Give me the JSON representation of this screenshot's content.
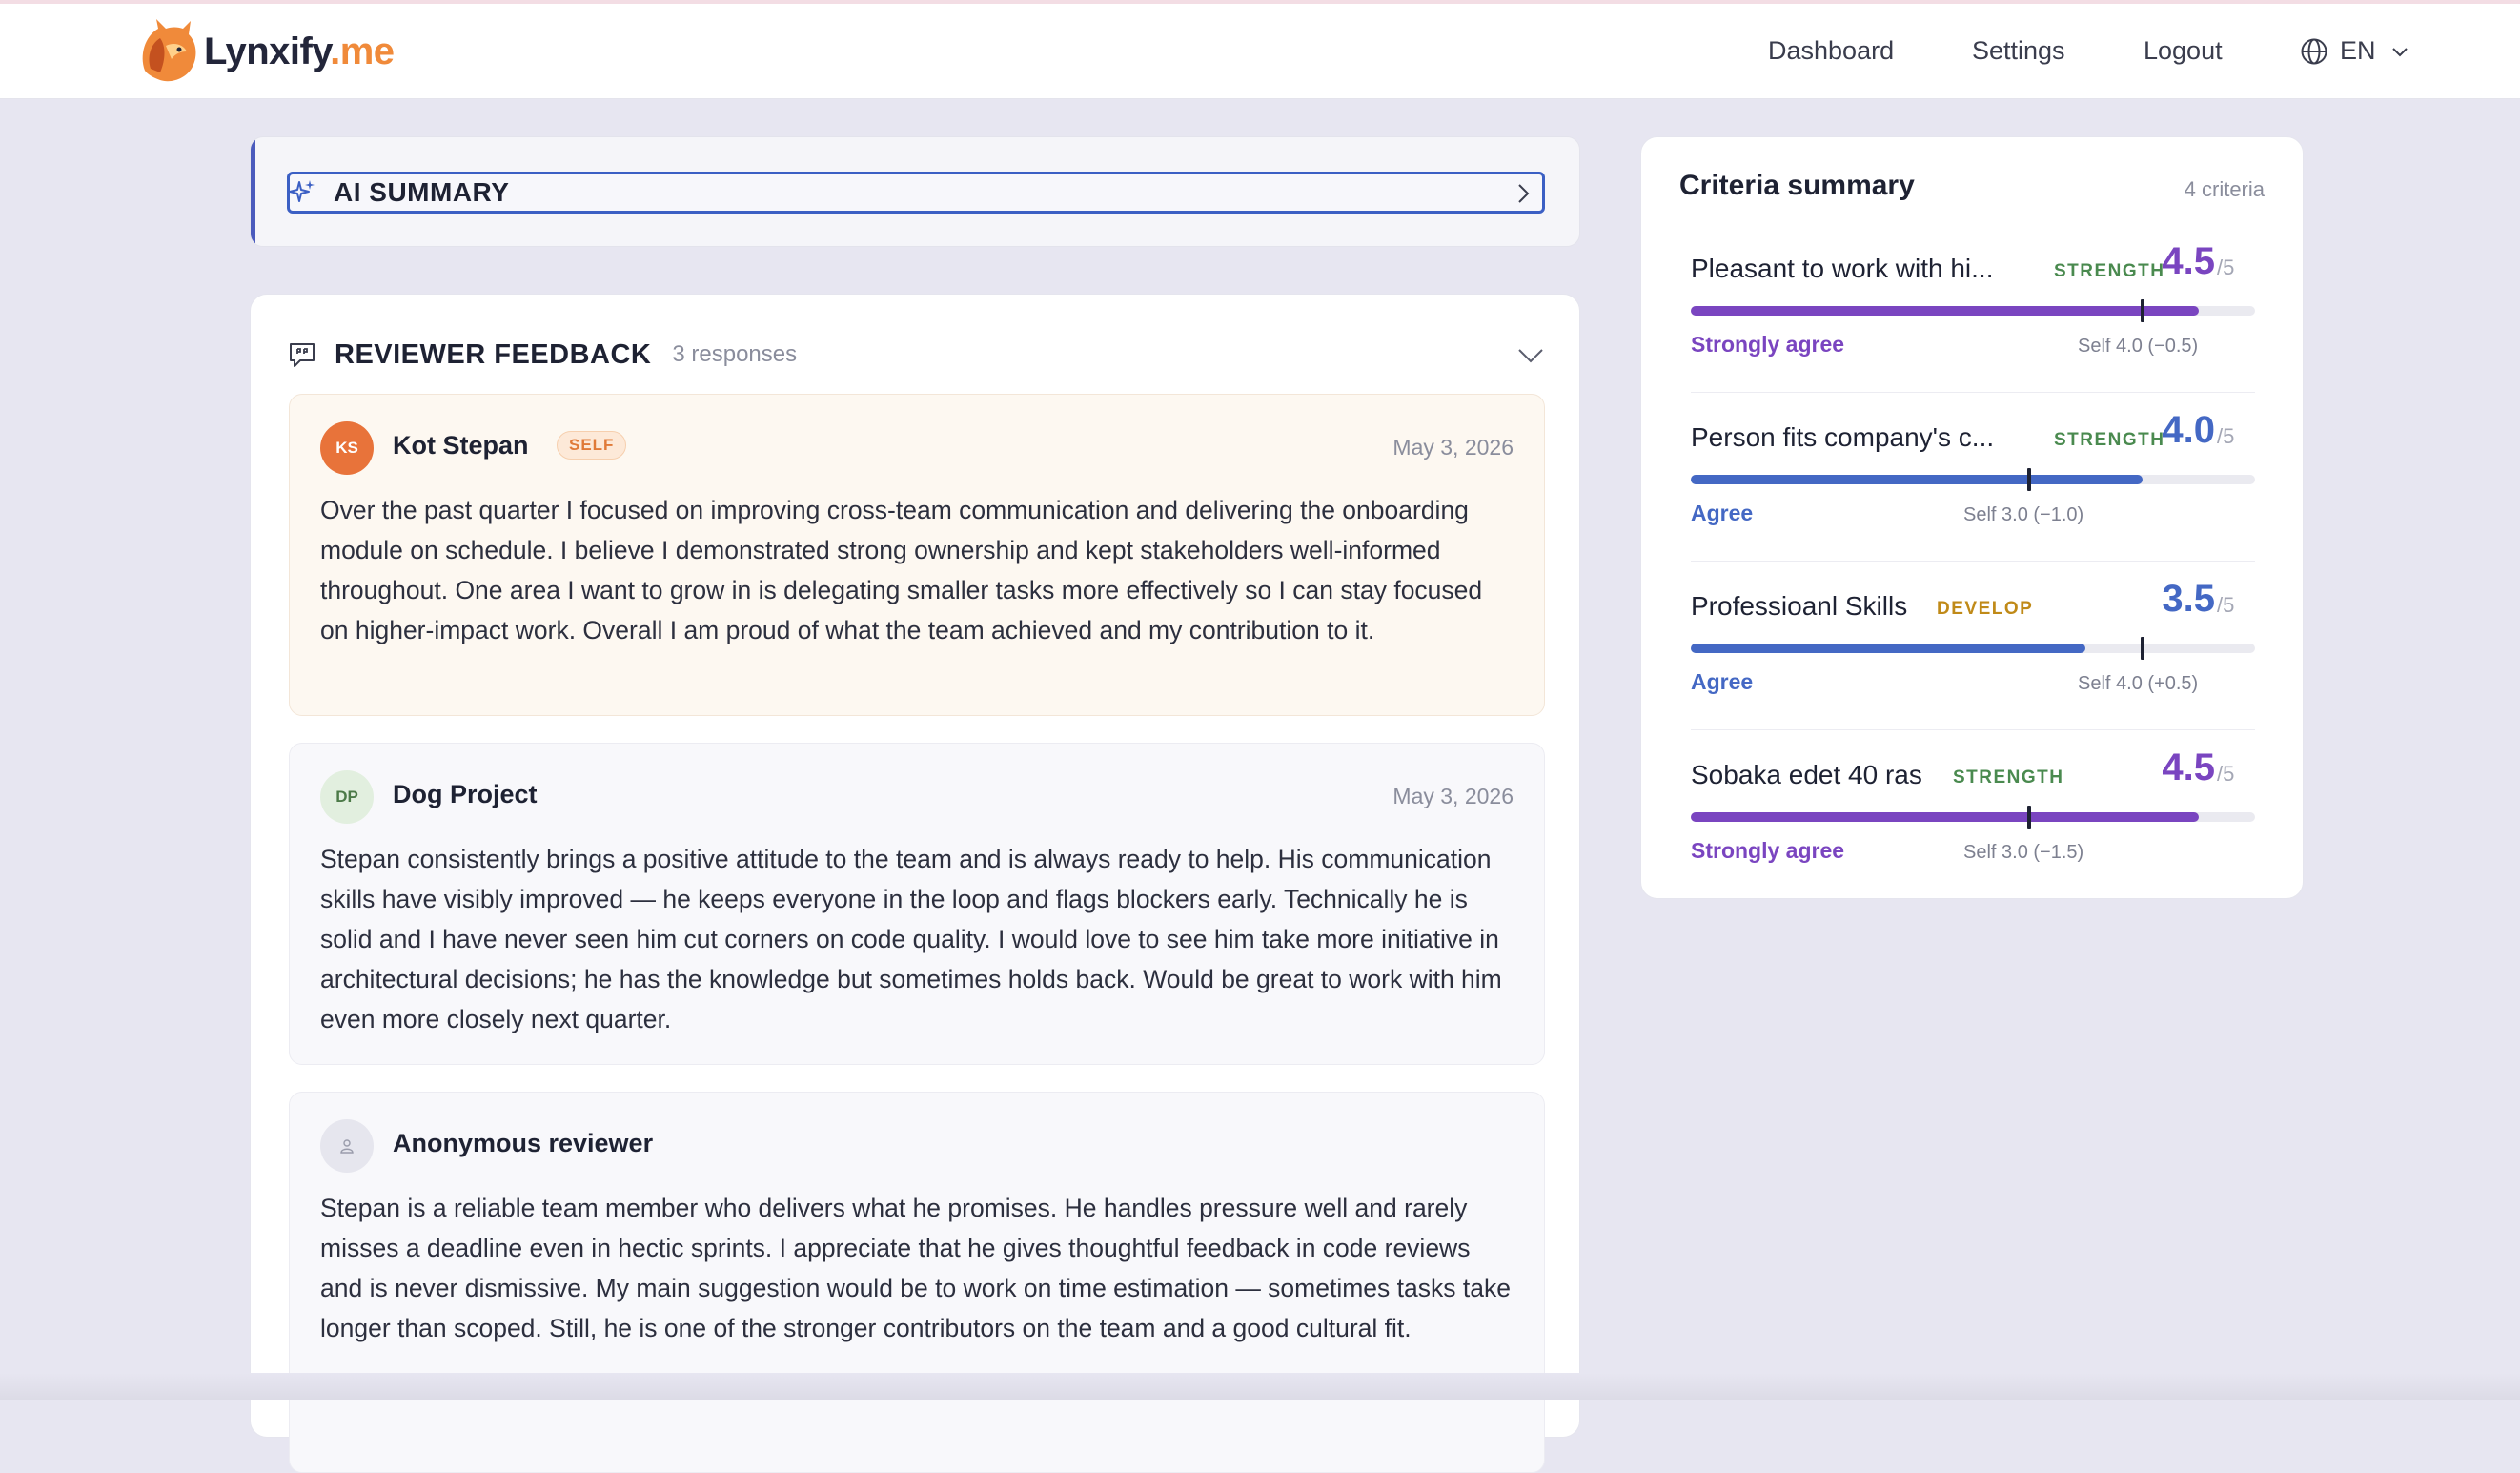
{
  "header": {
    "logo": {
      "text_main": "Lynxify",
      "text_suffix": ".me"
    },
    "nav": {
      "dashboard": "Dashboard",
      "settings": "Settings",
      "logout": "Logout"
    },
    "language": "EN"
  },
  "ai_summary": {
    "label": "AI SUMMARY"
  },
  "feedback": {
    "title": "REVIEWER FEEDBACK",
    "count": "3 responses",
    "reviews": [
      {
        "initials": "KS",
        "name": "Kot Stepan",
        "badge": "SELF",
        "date": "May 3, 2026",
        "text": "Over the past quarter I focused on improving cross-team communication and delivering the onboarding module on schedule. I believe I demonstrated strong ownership and kept stakeholders well-informed throughout. One area I want to grow in is delegating smaller tasks more effectively so I can stay focused on higher-impact work. Overall I am proud of what the team achieved and my contribution to it."
      },
      {
        "initials": "DP",
        "name": "Dog Project",
        "date": "May 3, 2026",
        "text": "Stepan consistently brings a positive attitude to the team and is always ready to help. His communication skills have visibly improved — he keeps everyone in the loop and flags blockers early. Technically he is solid and I have never seen him cut corners on code quality. I would love to see him take more initiative in architectural decisions; he has the knowledge but sometimes holds back. Would be great to work with him even more closely next quarter."
      },
      {
        "name": "Anonymous reviewer",
        "text": "Stepan is a reliable team member who delivers what he promises. He handles pressure well and rarely misses a deadline even in hectic sprints. I appreciate that he gives thoughtful feedback in code reviews and is never dismissive. My main suggestion would be to work on time estimation — sometimes tasks take longer than scoped. Still, he is one of the stronger contributors on the team and a good cultural fit."
      }
    ]
  },
  "criteria": {
    "title": "Criteria summary",
    "count": "4 criteria",
    "items": [
      {
        "name": "Pleasant to work with hi...",
        "tag": "STRENGTH",
        "score": "4.5",
        "out_of": "/5",
        "verdict": "Strongly agree",
        "self": "Self 4.0 (−0.5)",
        "score_value": 4.5,
        "self_value": 4.0,
        "color": "#7a45c0"
      },
      {
        "name": "Person fits company's c...",
        "tag": "STRENGTH",
        "score": "4.0",
        "out_of": "/5",
        "verdict": "Agree",
        "self": "Self 3.0 (−1.0)",
        "score_value": 4.0,
        "self_value": 3.0,
        "color": "#4468c4"
      },
      {
        "name": "Professioanl Skills",
        "tag": "DEVELOP",
        "score": "3.5",
        "out_of": "/5",
        "verdict": "Agree",
        "self": "Self 4.0 (+0.5)",
        "score_value": 3.5,
        "self_value": 4.0,
        "color": "#4468c4"
      },
      {
        "name": "Sobaka edet 40 ras",
        "tag": "STRENGTH",
        "score": "4.5",
        "out_of": "/5",
        "verdict": "Strongly agree",
        "self": "Self 3.0 (−1.5)",
        "score_value": 4.5,
        "self_value": 3.0,
        "color": "#7a45c0"
      }
    ]
  },
  "colors": {
    "accent_purple": "#7a45c0",
    "accent_blue": "#4468c4",
    "brand_orange": "#f08a3a",
    "strength_green": "#4a8a4f",
    "develop_amber": "#c08a18"
  }
}
